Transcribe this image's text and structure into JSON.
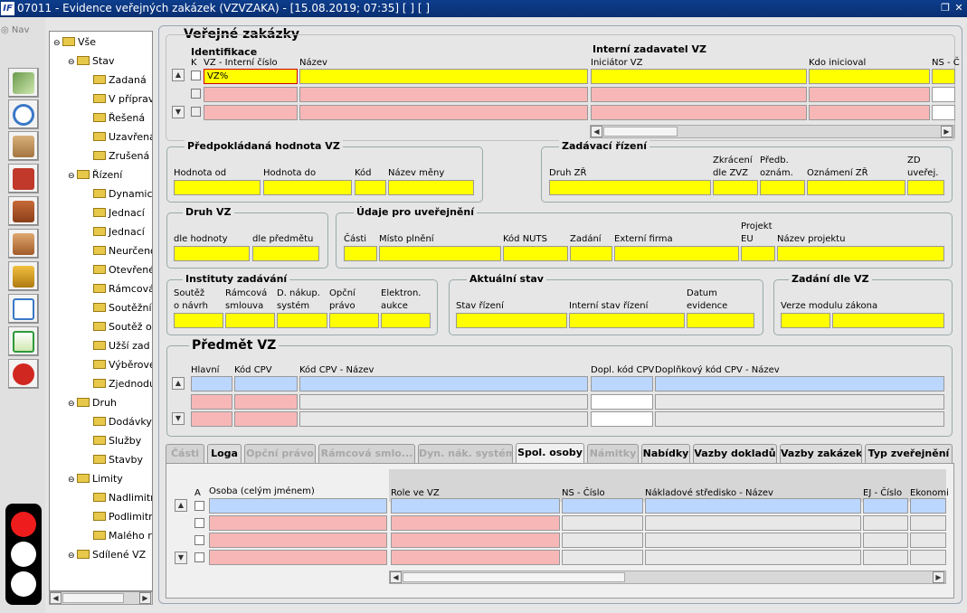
{
  "window": {
    "title": "07011 - Evidence veřejných zakázek (VZVZAKA) - [15.08.2019; 07:35]  [ ]  [ ]",
    "logo_text": "IF",
    "restore_icon": "restore-icon",
    "close_icon": "close-icon"
  },
  "nav": {
    "label": "Nav"
  },
  "toolbar": [
    "money-icon",
    "clock-icon",
    "notebook-icon",
    "briefcase-icon",
    "factory-icon",
    "person-icon",
    "scales-icon",
    "document-icon",
    "add-document-icon",
    "refresh-icon"
  ],
  "tree": [
    {
      "label": "Vše",
      "level": 0
    },
    {
      "label": "Stav",
      "level": 1
    },
    {
      "label": "Zadaná",
      "level": 2
    },
    {
      "label": "V přípravě",
      "level": 2
    },
    {
      "label": "Řešená",
      "level": 2
    },
    {
      "label": "Uzavřená",
      "level": 2
    },
    {
      "label": "Zrušená",
      "level": 2
    },
    {
      "label": "Řízení",
      "level": 1
    },
    {
      "label": "Dynamický",
      "level": 2
    },
    {
      "label": "Jednací",
      "level": 2
    },
    {
      "label": "Jednací",
      "level": 2
    },
    {
      "label": "Neurčeno",
      "level": 2
    },
    {
      "label": "Otevřené",
      "level": 2
    },
    {
      "label": "Rámcová",
      "level": 2
    },
    {
      "label": "Soutěžní",
      "level": 2
    },
    {
      "label": "Soutěž o",
      "level": 2
    },
    {
      "label": "Užší zad",
      "level": 2
    },
    {
      "label": "Výběrové",
      "level": 2
    },
    {
      "label": "Zjednodu",
      "level": 2
    },
    {
      "label": "Druh",
      "level": 1
    },
    {
      "label": "Dodávky",
      "level": 2
    },
    {
      "label": "Služby",
      "level": 2
    },
    {
      "label": "Stavby",
      "level": 2
    },
    {
      "label": "Limity",
      "level": 1
    },
    {
      "label": "Nadlimitní",
      "level": 2
    },
    {
      "label": "Podlimitní",
      "level": 2
    },
    {
      "label": "Malého r",
      "level": 2
    },
    {
      "label": "Sdílené VZ",
      "level": 1
    }
  ],
  "main": {
    "title": "Veřejné zakázky",
    "ident": {
      "title": "Identifikace",
      "col_k": "K",
      "col_vz": "VZ - Interní číslo",
      "col_nazev": "Název",
      "vz_value": "VZ%"
    },
    "interni": {
      "title": "Interní zadavatel VZ",
      "col_iniciator": "Iniciátor VZ",
      "col_kdo": "Kdo inicioval",
      "col_ns": "NS - Č"
    },
    "predpokladana": {
      "title": "Předpokládaná hodnota VZ",
      "od": "Hodnota od",
      "do": "Hodnota do",
      "kod": "Kód",
      "mena": "Název měny"
    },
    "zadavaci": {
      "title": "Zadávací řízení",
      "druh": "Druh ZŘ",
      "zkraceni1": "Zkrácení",
      "zkraceni2": "dle ZVZ",
      "predb1": "Předb.",
      "predb2": "oznám.",
      "oznameni": "Oznámení ZŘ",
      "zd1": "ZD",
      "zd2": "uveřej."
    },
    "druh": {
      "title": "Druh VZ",
      "hodnoty": "dle hodnoty",
      "predmetu": "dle předmětu"
    },
    "udaje": {
      "title": "Údaje pro uveřejnění",
      "casti": "Části",
      "misto": "Místo plnění",
      "nuts": "Kód NUTS",
      "zadani": "Zadání",
      "firma": "Externí firma",
      "projekt1": "Projekt",
      "projekt2": "EU",
      "nazev_projektu": "Název projektu"
    },
    "instituty": {
      "title": "Instituty zadávání",
      "soutez1": "Soutěž",
      "soutez2": "o návrh",
      "ramcova1": "Rámcová",
      "ramcova2": "smlouva",
      "dnak1": "D. nákup.",
      "dnak2": "systém",
      "opcni1": "Opční",
      "opcni2": "právo",
      "elektron1": "Elektron.",
      "elektron2": "aukce"
    },
    "aktualni": {
      "title": "Aktuální stav",
      "stav": "Stav řízení",
      "interni_stav": "Interní stav řízení",
      "datum1": "Datum",
      "datum2": "evidence"
    },
    "zadani_vz": {
      "title": "Zadání dle VZ",
      "verze": "Verze modulu zákona"
    },
    "predmet": {
      "title": "Předmět VZ",
      "hlavni": "Hlavní",
      "kod_cpv": "Kód CPV",
      "kod_cpv_nazev": "Kód CPV - Název",
      "dopl_kod": "Dopl. kód CPV",
      "dopl_nazev": "Doplňkový kód CPV - Název"
    },
    "tabs": [
      {
        "label": "Části",
        "state": "dis"
      },
      {
        "label": "Loga",
        "state": "on"
      },
      {
        "label": "Opční právo",
        "state": "dis"
      },
      {
        "label": "Rámcová smlo...",
        "state": "dis"
      },
      {
        "label": "Dyn. nák. systém",
        "state": "dis"
      },
      {
        "label": "Spol. osoby",
        "state": "act"
      },
      {
        "label": "Námitky",
        "state": "dis"
      },
      {
        "label": "Nabídky",
        "state": "on"
      },
      {
        "label": "Vazby dokladů",
        "state": "on"
      },
      {
        "label": "Vazby zakázek",
        "state": "on"
      },
      {
        "label": "Typ zveřejnění",
        "state": "on"
      }
    ],
    "osoby": {
      "col_a": "A",
      "osoba": "Osoba (celým jménem)",
      "role": "Role ve VZ",
      "ns": "NS - Číslo",
      "nakladove": "Nákladové středisko - Název",
      "ej": "EJ - Číslo",
      "ekonomicka": "Ekonomi"
    }
  },
  "traffic_light": {
    "active": "red"
  }
}
